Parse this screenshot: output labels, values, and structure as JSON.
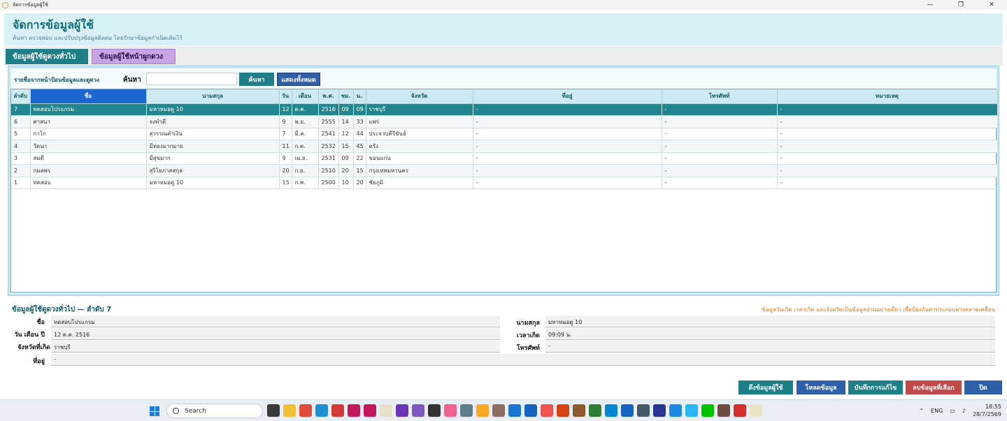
{
  "window": {
    "title": "จัดการข้อมูลผู้ใช้",
    "controls": {
      "minimize": "—",
      "restore": "❐",
      "close": "✕"
    }
  },
  "header": {
    "title": "จัดการข้อมูลผู้ใช้",
    "subtitle": "ค้นหา ตรวจสอบ และปรับปรุงข้อมูลติดต่อ โดยรักษาข้อมูลกำเนิดเดิมไว้"
  },
  "tabs": [
    {
      "label": "ข้อมูลผู้ใช้ดูดวงทั่วไป",
      "active": true
    },
    {
      "label": "ข้อมูลผู้ใช้หน้าผูกดวง",
      "active": false
    }
  ],
  "search": {
    "list_label": "รายชื่อจากหน้าป้อนข้อมูลและดูดวง",
    "caption": "ค้นหา",
    "value": "",
    "placeholder": "",
    "search_button": "ค้นหา",
    "show_all_button": "แสดงทั้งหมด"
  },
  "table": {
    "columns": [
      "ลำดับ",
      "ชื่อ",
      "นามสกุล",
      "วัน",
      "เดือน",
      "พ.ศ.",
      "ชม.",
      "น.",
      "จังหวัด",
      "ที่อยู่",
      "โทรศัพท์",
      "หมายเหตุ"
    ],
    "rows": [
      [
        "7",
        "ทดสอบโปรแกรม",
        "มหาหมอดู 10",
        "12",
        "ต.ค.",
        "2516",
        "09",
        "09",
        "ราชบุรี",
        "-",
        "-",
        "-"
      ],
      [
        "6",
        "ศาสนา",
        "จงทำดี",
        "9",
        "พ.ย.",
        "2555",
        "14",
        "33",
        "แพร่",
        "-",
        "-",
        "-"
      ],
      [
        "5",
        "กาโก",
        "สุวรรณคำเงิน",
        "7",
        "มี.ค.",
        "2541",
        "12",
        "44",
        "ประจวบคีรีขันธ์",
        "-",
        "-",
        "-"
      ],
      [
        "4",
        "วัดนา",
        "มีทองมากมาย",
        "11",
        "ก.ค.",
        "2532",
        "15",
        "45",
        "ตรัง",
        "-",
        "-",
        "-"
      ],
      [
        "3",
        "สมดี",
        "มีสุขมาก",
        "9",
        "เม.ย.",
        "2531",
        "09",
        "22",
        "ขอนแก่น",
        "-",
        "-",
        "-"
      ],
      [
        "2",
        "กมลพร",
        "สุริโยภาสสกุล",
        "20",
        "ก.ย.",
        "2510",
        "20",
        "15",
        "กรุงเทพมหานคร",
        "-",
        "-",
        "-"
      ],
      [
        "1",
        "ทดสอบ",
        "มหาหมอดู 10",
        "15",
        "ก.พ.",
        "2500",
        "10",
        "20",
        "ชัยภูมิ",
        "-",
        "-",
        "-"
      ]
    ],
    "selected_index": 0
  },
  "detail": {
    "title": "ข้อมูลผู้ใช้ดูดวงทั่วไป — ลำดับ 7",
    "note": "ข้อมูลวันเกิด เวลาเกิด และจังหวัดเป็นข้อมูลอ่านอย่างเดียว เพื่อป้องกันค่าประกอบดวงคลาดเคลื่อน",
    "labels": {
      "name": "ชื่อ",
      "birthdate": "วัน เดือน ปี",
      "province": "จังหวัดที่เกิด",
      "address": "ที่อยู่",
      "surname": "นามสกุล",
      "birthtime": "เวลาเกิด",
      "phone": "โทรศัพท์"
    },
    "values": {
      "name": "ทดสอบโปรแกรม",
      "birthdate": "12 ต.ค. 2516",
      "province": "ราชบุรี",
      "address": "-",
      "surname": "มหาหมอดู 10",
      "birthtime": "09:09 น.",
      "phone": "-"
    }
  },
  "footer": {
    "fetch": "ดึงข้อมูลผู้ใช้",
    "load": "โหลดข้อมูล",
    "save": "บันทึกการแก้ไข",
    "delete": "ลบข้อมูลที่เลือก",
    "close": "ปิด"
  },
  "taskbar": {
    "search": "Search",
    "lang": "ENG",
    "time": "18:55",
    "date": "28/7/2569"
  }
}
